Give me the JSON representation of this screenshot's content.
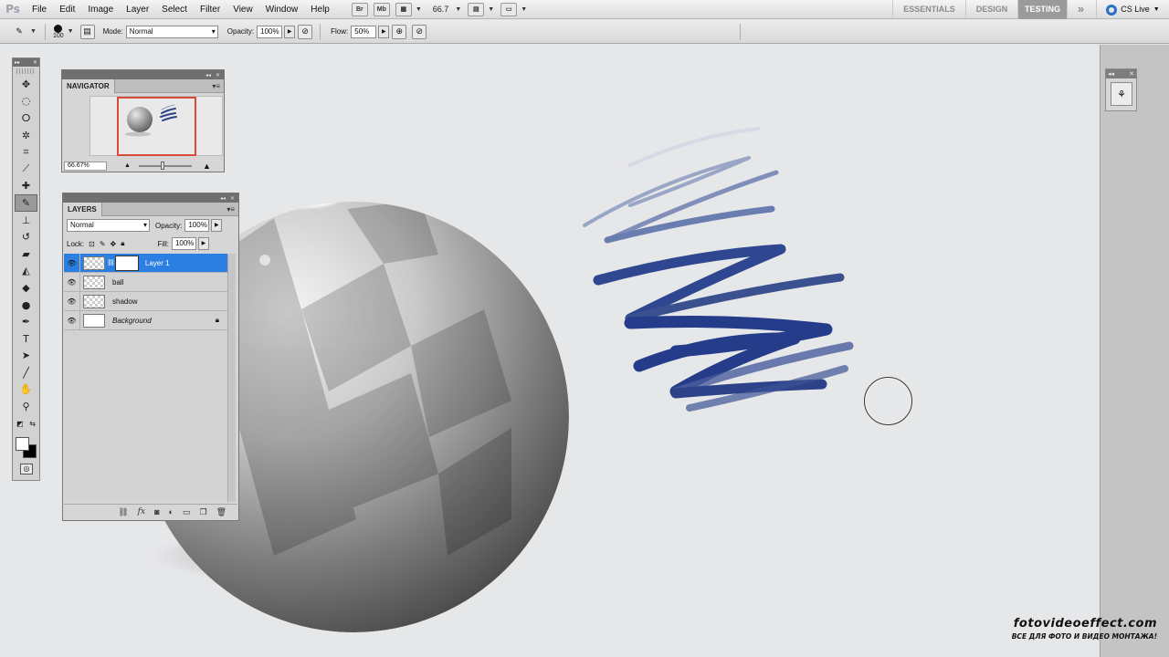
{
  "app": {
    "logo": "Ps"
  },
  "menu": [
    "File",
    "Edit",
    "Image",
    "Layer",
    "Select",
    "Filter",
    "View",
    "Window",
    "Help"
  ],
  "appbar": {
    "bridge_label": "Br",
    "minibridge_label": "Mb",
    "zoom": "66.7"
  },
  "workspaces": [
    {
      "label": "ESSENTIALS",
      "active": false
    },
    {
      "label": "DESIGN",
      "active": false
    },
    {
      "label": "TESTING",
      "active": true
    }
  ],
  "more_label": "»",
  "cslive": "CS Live",
  "options": {
    "brush_size": "100",
    "mode_label": "Mode:",
    "mode_value": "Normal",
    "opacity_label": "Opacity:",
    "opacity_value": "100%",
    "flow_label": "Flow:",
    "flow_value": "50%"
  },
  "navigator": {
    "title": "NAVIGATOR",
    "zoom": "66.67%"
  },
  "layers": {
    "title": "LAYERS",
    "blend_mode": "Normal",
    "opacity_label": "Opacity:",
    "opacity_value": "100%",
    "lock_label": "Lock:",
    "fill_label": "Fill:",
    "fill_value": "100%",
    "items": [
      {
        "name": "Layer 1",
        "selected": true
      },
      {
        "name": "ball",
        "selected": false
      },
      {
        "name": "shadow",
        "selected": false
      },
      {
        "name": "Background",
        "selected": false
      }
    ]
  },
  "colors": {
    "foreground": "#ffffff",
    "background": "#000000",
    "selection": "#2b7fe3",
    "stroke": "#243c8a"
  },
  "watermark": {
    "line1": "fotovideoeffect.com",
    "line2": "ВСЕ ДЛЯ ФОТО И ВИДЕО МОНТАЖА!"
  }
}
